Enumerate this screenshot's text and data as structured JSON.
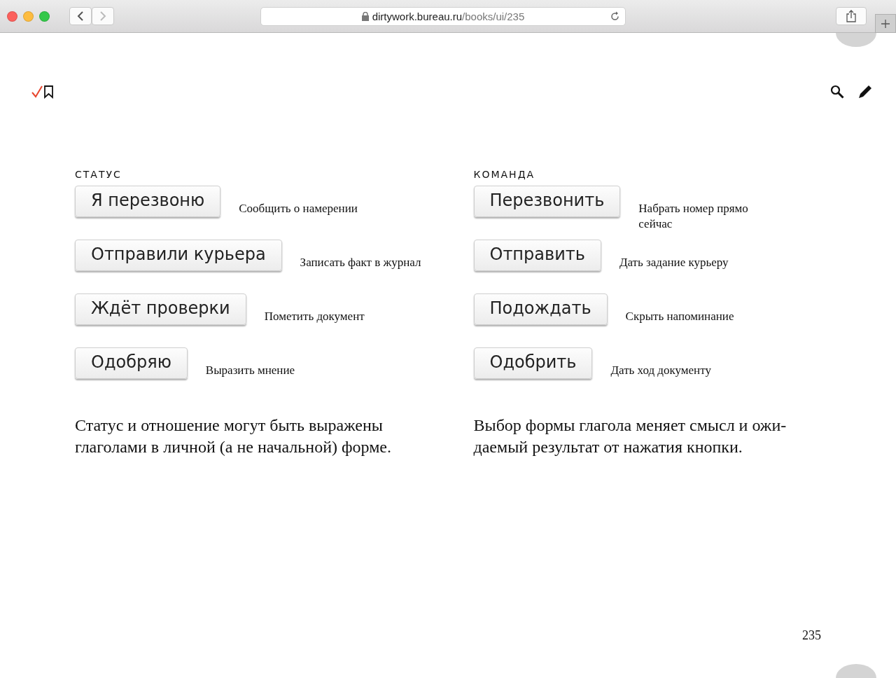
{
  "browser": {
    "url_host": "dirtywork.bureau.ru",
    "url_path": "/books/ui/235"
  },
  "columns": [
    {
      "heading": "СТАТУС",
      "items": [
        {
          "button": "Я перезвоню",
          "hint": "Сообщить о намерении"
        },
        {
          "button": "Отправили курьера",
          "hint": "Записать факт в журнал"
        },
        {
          "button": "Ждёт проверки",
          "hint": "Пометить документ"
        },
        {
          "button": "Одобряю",
          "hint": "Выразить мнение"
        }
      ],
      "note": "Статус и отношение могут быть выражены глаголами в личной (а не начальной) форме."
    },
    {
      "heading": "КОМАНДА",
      "items": [
        {
          "button": "Перезвонить",
          "hint": "Набрать номер прямо сейчас"
        },
        {
          "button": "Отправить",
          "hint": "Дать задание курьеру"
        },
        {
          "button": "Подождать",
          "hint": "Скрыть напоминание"
        },
        {
          "button": "Одобрить",
          "hint": "Дать ход документу"
        }
      ],
      "note": "Выбор формы глагола меняет смысл и ожи-даемый результат от нажатия кнопки."
    }
  ],
  "page_number": "235"
}
